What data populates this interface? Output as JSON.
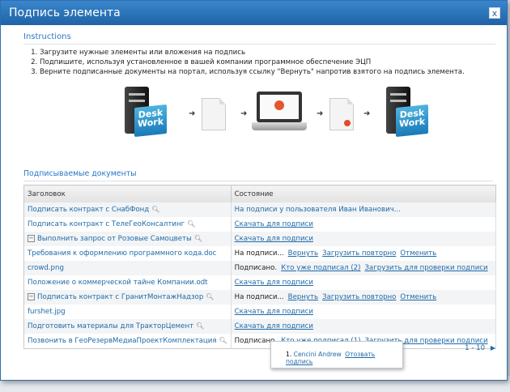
{
  "dialog": {
    "title": "Подпись элемента",
    "close_label": "x"
  },
  "instructions": {
    "heading": "Instructions",
    "steps": [
      "Загрузите нужные элементы или вложения на подпись",
      "Подпишите, используя установленное в вашей компании программное обеспечение ЭЦП",
      "Верните подписанные документы на портал, используя ссылку \"Вернуть\" напротив взятого на подпись элемента."
    ]
  },
  "flow": {
    "logo_text_1": "Desk",
    "logo_text_2": "Work"
  },
  "documents": {
    "heading": "Подписываемые документы",
    "col_title": "Заголовок",
    "col_status": "Состояние",
    "rows": [
      {
        "title": "Подписать контракт с СнабФонд",
        "status": "На подписи у пользователя Иван Иванович...",
        "actions": [],
        "mag": true,
        "expand": false,
        "level": 0
      },
      {
        "title": "Подписать контракт с ТелеГеоКонсалтинг",
        "status": "",
        "actions": [
          "Скачать для подписи"
        ],
        "mag": true,
        "expand": false,
        "level": 0
      },
      {
        "title": "Выполнить запрос от Розовые Самоцветы",
        "status": "",
        "actions": [
          "Скачать для подписи"
        ],
        "mag": true,
        "expand": true,
        "level": 0
      },
      {
        "title": "Требования к оформлению программного кода.doc",
        "status": "На подписи...",
        "actions": [
          "Вернуть",
          "Загрузить повторно",
          "Отменить"
        ],
        "mag": false,
        "expand": false,
        "level": 1
      },
      {
        "title": "crowd.png",
        "status": "Подписано.",
        "actions": [
          "Кто уже подписал (2)",
          "Загрузить для проверки подписи"
        ],
        "mag": false,
        "expand": false,
        "level": 1
      },
      {
        "title": "Положение о коммерческой тайне Компании.odt",
        "status": "",
        "actions": [
          "Скачать для подписи"
        ],
        "mag": false,
        "expand": false,
        "level": 1
      },
      {
        "title": "Подписать контракт с ГранитМонтажНадзор",
        "status": "На подписи...",
        "actions": [
          "Вернуть",
          "Загрузить повторно",
          "Отменить"
        ],
        "mag": true,
        "expand": true,
        "level": 0
      },
      {
        "title": "furshet.jpg",
        "status": "",
        "actions": [
          "Скачать для подписи"
        ],
        "mag": false,
        "expand": false,
        "level": 1
      },
      {
        "title": "Подготовить материалы для ТракторЦемент",
        "status": "",
        "actions": [
          "Скачать для подписи"
        ],
        "mag": true,
        "expand": false,
        "level": 0
      },
      {
        "title": "Позвонить в ГеоРезервМедиаПроектКомплектация",
        "status": "Подписано.",
        "actions": [
          "Кто уже подписал (1)",
          "Загрузить для проверки подписи"
        ],
        "mag": true,
        "expand": false,
        "level": 0
      }
    ]
  },
  "pager": {
    "range": "1 - 10",
    "next": "▶"
  },
  "popup": {
    "number": "1.",
    "signer": "Cencini Andrew",
    "revoke": "Отозвать подпись"
  },
  "colors": {
    "title_bar": "#2a77c8",
    "link": "#1e6aa8",
    "seal": "#e24b2b"
  }
}
